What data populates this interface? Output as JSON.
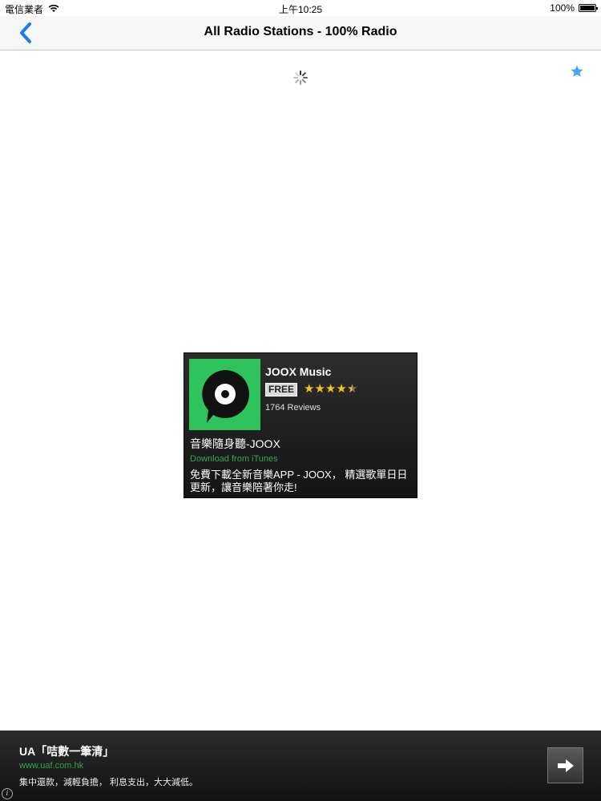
{
  "status_bar": {
    "carrier": "電信業者",
    "time": "上午10:25",
    "battery": "100%"
  },
  "nav": {
    "back_icon": "chevron-left-icon",
    "title": "All Radio Stations - 100% Radio"
  },
  "content": {
    "favorite_icon": "star-icon",
    "loading_icon": "spinner-icon"
  },
  "ad_card": {
    "app_name": "JOOX Music",
    "price_badge": "FREE",
    "rating_stars": 4.5,
    "reviews": "1764 Reviews",
    "headline": "音樂隨身聽-JOOX",
    "source": "Download from iTunes",
    "description": "免費下載全新音樂APP - JOOX， 精選歌單日日更新，讓音樂陪著你走!"
  },
  "banner": {
    "title": "UA「咭數一筆清」",
    "url": "www.uaf.com.hk",
    "description": "集中還款，減輕負擔， 利息支出，大大減低。",
    "arrow_icon": "arrow-right-icon",
    "info_icon": "info-icon"
  },
  "colors": {
    "accent_blue": "#1a7cf5",
    "star_blue": "#3fa9f5",
    "joox_green": "#2ec35b",
    "star_yellow": "#f5c518"
  }
}
